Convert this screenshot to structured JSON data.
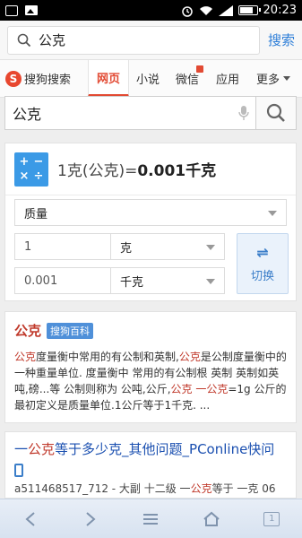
{
  "status_bar": {
    "time": "20:23"
  },
  "top_search": {
    "query": "公克",
    "button_label": "搜索"
  },
  "tabs": {
    "logo_text": "搜狗搜索",
    "items": [
      {
        "label": "网页",
        "active": true
      },
      {
        "label": "小说"
      },
      {
        "label": "微信"
      },
      {
        "label": "应用"
      },
      {
        "label": "更多"
      }
    ]
  },
  "main_search": {
    "query": "公克"
  },
  "converter": {
    "result_prefix": "1克(公克)=",
    "result_value": "0.001千克",
    "category": "质量",
    "from_value": "1",
    "from_unit": "克",
    "to_value": "0.001",
    "to_unit": "千克",
    "swap_label": "切换",
    "calc_symbols": [
      "+",
      "−",
      "×",
      "÷"
    ]
  },
  "baike": {
    "title": "公克",
    "tag": "搜狗百科",
    "body": [
      {
        "text": "公克",
        "hl": true
      },
      {
        "text": "度量衡中常用的有公制和英制,"
      },
      {
        "text": "公克",
        "hl": true
      },
      {
        "text": "是公制度量衡中的一种重量单位. 度量衡中 常用的有公制根 英制 英制如英吨,磅...等 公制则称为 公吨,公斤,"
      },
      {
        "text": "公克 一公克",
        "hl": true
      },
      {
        "text": "=1g 公斤的最初定义是质量单位.1公斤等于1千克. ..."
      }
    ]
  },
  "result": {
    "title_parts": [
      {
        "text": "一"
      },
      {
        "text": "公克",
        "hl": true
      },
      {
        "text": "等于多少克_其他问题_PConline快问"
      }
    ],
    "sub_parts": [
      {
        "text": "a511468517_712 - 大副 十二级 一"
      },
      {
        "text": "公克",
        "hl": true
      },
      {
        "text": "等于 一克 06"
      }
    ]
  },
  "bottom_nav": {
    "tab_count": "1"
  }
}
